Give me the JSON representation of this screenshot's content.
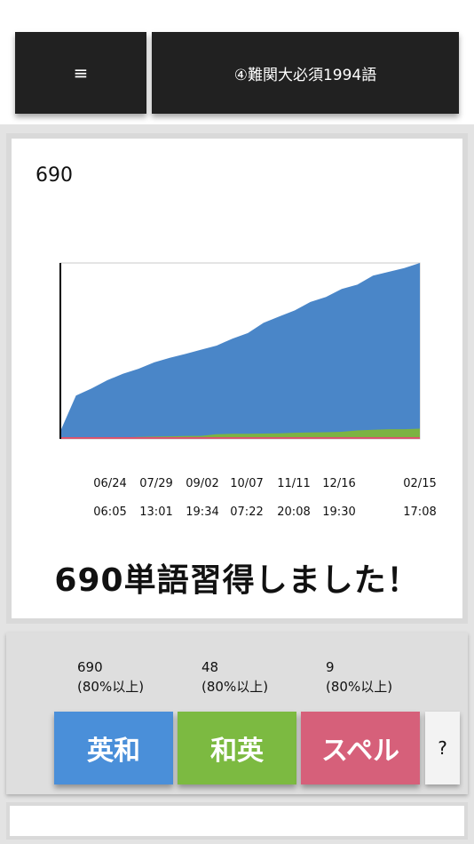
{
  "header": {
    "menu_icon": "≡",
    "title": "④難関大必須1994語"
  },
  "progress": {
    "count": "690",
    "message": "690単語習得しました！"
  },
  "chart_data": {
    "type": "area",
    "x_tick_dates": [
      "06/24",
      "07/29",
      "09/02",
      "10/07",
      "11/11",
      "12/16",
      "02/15"
    ],
    "x_tick_times": [
      "06:05",
      "13:01",
      "19:34",
      "07:22",
      "20:08",
      "19:30",
      "17:08"
    ],
    "colors": {
      "eiwa": "#4a86c8",
      "waei": "#7cb342",
      "spell": "#d9546e"
    },
    "series": [
      {
        "values": [
          30,
          170,
          198,
          230,
          255,
          275,
          300,
          318,
          333,
          350,
          366,
          393,
          415,
          455,
          480,
          504,
          537,
          557,
          588,
          605,
          640,
          655,
          670,
          690
        ]
      },
      {
        "values": [
          0,
          2,
          3,
          5,
          6,
          8,
          9,
          10,
          11,
          12,
          18,
          20,
          20,
          21,
          22,
          24,
          25,
          26,
          28,
          33,
          36,
          38,
          38,
          40
        ]
      },
      {
        "values": [
          0,
          0,
          0,
          0,
          0,
          0,
          0,
          0,
          0,
          0,
          0,
          0,
          0,
          0,
          0,
          0,
          0,
          0,
          0,
          0,
          0,
          0,
          0,
          1
        ]
      }
    ],
    "ylim": [
      0,
      690
    ]
  },
  "stats": [
    {
      "value": "690",
      "note": "(80%以上)"
    },
    {
      "value": "48",
      "note": "(80%以上)"
    },
    {
      "value": "9",
      "note": "(80%以上)"
    }
  ],
  "buttons": {
    "eiwa": "英和",
    "waei": "和英",
    "spell": "スペル",
    "help": "?"
  }
}
